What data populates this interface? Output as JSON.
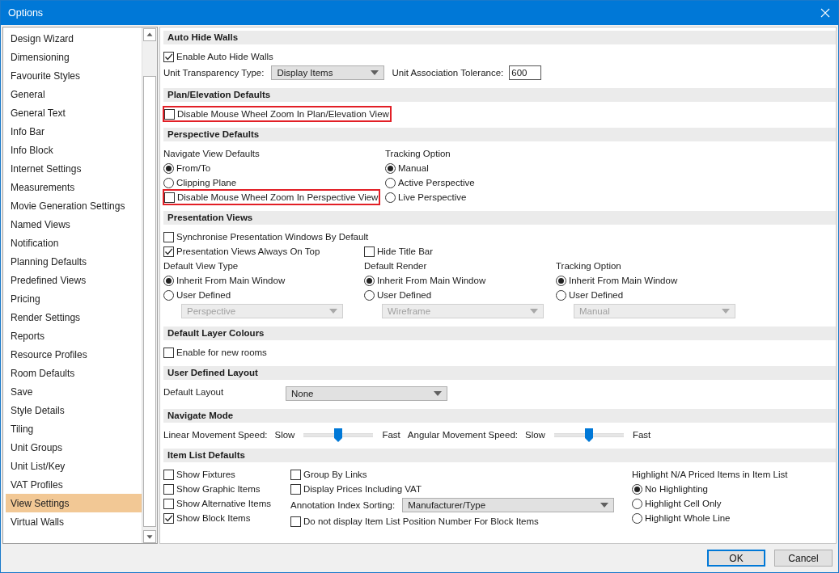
{
  "window": {
    "title": "Options"
  },
  "sidebar": {
    "items": [
      {
        "label": "Design Wizard",
        "selected": false
      },
      {
        "label": "Dimensioning",
        "selected": false
      },
      {
        "label": "Favourite Styles",
        "selected": false
      },
      {
        "label": "General",
        "selected": false
      },
      {
        "label": "General Text",
        "selected": false
      },
      {
        "label": "Info Bar",
        "selected": false
      },
      {
        "label": "Info Block",
        "selected": false
      },
      {
        "label": "Internet Settings",
        "selected": false
      },
      {
        "label": "Measurements",
        "selected": false
      },
      {
        "label": "Movie Generation Settings",
        "selected": false
      },
      {
        "label": "Named Views",
        "selected": false
      },
      {
        "label": "Notification",
        "selected": false
      },
      {
        "label": "Planning Defaults",
        "selected": false
      },
      {
        "label": "Predefined Views",
        "selected": false
      },
      {
        "label": "Pricing",
        "selected": false
      },
      {
        "label": "Render Settings",
        "selected": false
      },
      {
        "label": "Reports",
        "selected": false
      },
      {
        "label": "Resource Profiles",
        "selected": false
      },
      {
        "label": "Room Defaults",
        "selected": false
      },
      {
        "label": "Save",
        "selected": false
      },
      {
        "label": "Style Details",
        "selected": false
      },
      {
        "label": "Tiling",
        "selected": false
      },
      {
        "label": "Unit Groups",
        "selected": false
      },
      {
        "label": "Unit List/Key",
        "selected": false
      },
      {
        "label": "VAT Profiles",
        "selected": false
      },
      {
        "label": "View Settings",
        "selected": true
      },
      {
        "label": "Virtual Walls",
        "selected": false
      }
    ]
  },
  "sections": [
    {
      "title": "Auto Hide Walls",
      "kind": "single",
      "blocks": [
        {
          "columns": [
            [
              {
                "kind": "checkbox",
                "label": "Enable Auto Hide Walls",
                "checked": true,
                "highlighted": false
              }
            ]
          ]
        },
        {
          "columns": [
            [
              {
                "kind": "line",
                "items": [
                  {
                    "kind": "label",
                    "text": "Unit Transparency Type:"
                  },
                  {
                    "kind": "dropdown",
                    "value": "Display Items",
                    "disabled": false
                  },
                  {
                    "kind": "label",
                    "text": "Unit Association Tolerance:"
                  },
                  {
                    "kind": "field",
                    "value": "600"
                  }
                ]
              }
            ]
          ]
        }
      ]
    },
    {
      "title": "Plan/Elevation Defaults",
      "kind": "single",
      "blocks": [
        {
          "columns": [
            [
              {
                "kind": "checkbox",
                "label": "Disable Mouse Wheel Zoom In Plan/Elevation View",
                "checked": false,
                "highlighted": true
              }
            ]
          ]
        }
      ]
    },
    {
      "title": "Perspective Defaults",
      "kind": "two",
      "blocks": [
        {
          "columns": [
            [
              {
                "kind": "label",
                "text": "Navigate View Defaults"
              },
              {
                "kind": "radio",
                "label": "From/To",
                "selected": true
              },
              {
                "kind": "radio",
                "label": "Clipping Plane",
                "selected": false
              },
              {
                "kind": "checkbox",
                "label": "Disable Mouse Wheel Zoom In Perspective View",
                "checked": false,
                "highlighted": true
              }
            ],
            [
              {
                "kind": "label",
                "text": "Tracking Option"
              },
              {
                "kind": "radio",
                "label": "Manual",
                "selected": true
              },
              {
                "kind": "radio",
                "label": "Active Perspective",
                "selected": false
              },
              {
                "kind": "radio",
                "label": "Live Perspective",
                "selected": false
              }
            ]
          ]
        }
      ]
    },
    {
      "title": "Presentation Views",
      "kind": "three",
      "blocks": [
        {
          "columns": [
            [
              {
                "kind": "checkbox",
                "label": "Synchronise Presentation Windows By Default",
                "checked": false,
                "highlighted": false
              }
            ]
          ]
        },
        {
          "columns": [
            [
              {
                "kind": "checkbox",
                "label": "Presentation Views Always On Top",
                "checked": true,
                "highlighted": false
              }
            ],
            [
              {
                "kind": "checkbox",
                "label": "Hide Title Bar",
                "checked": false,
                "highlighted": false
              }
            ]
          ]
        },
        {
          "columns": [
            [
              {
                "kind": "label",
                "text": "Default View Type"
              },
              {
                "kind": "radio",
                "label": "Inherit From Main Window",
                "selected": true
              },
              {
                "kind": "radio",
                "label": "User Defined",
                "selected": false
              },
              {
                "kind": "dropdown",
                "value": "Perspective",
                "disabled": true
              }
            ],
            [
              {
                "kind": "label",
                "text": "Default Render"
              },
              {
                "kind": "radio",
                "label": "Inherit From Main Window",
                "selected": true
              },
              {
                "kind": "radio",
                "label": "User Defined",
                "selected": false
              },
              {
                "kind": "dropdown",
                "value": "Wireframe",
                "disabled": true
              }
            ],
            [
              {
                "kind": "label",
                "text": "Tracking Option"
              },
              {
                "kind": "radio",
                "label": "Inherit From Main Window",
                "selected": true
              },
              {
                "kind": "radio",
                "label": "User Defined",
                "selected": false
              },
              {
                "kind": "dropdown",
                "value": "Manual",
                "disabled": true
              }
            ]
          ]
        }
      ]
    },
    {
      "title": "Default Layer Colours",
      "kind": "single",
      "blocks": [
        {
          "columns": [
            [
              {
                "kind": "checkbox",
                "label": "Enable for new rooms",
                "checked": false,
                "highlighted": false
              }
            ]
          ]
        }
      ]
    },
    {
      "title": "User Defined Layout",
      "kind": "form",
      "blocks": [
        {
          "columns": [
            [
              {
                "kind": "label",
                "text": "Default Layout"
              }
            ],
            [
              {
                "kind": "dropdown",
                "value": "None",
                "disabled": false
              }
            ]
          ]
        }
      ]
    },
    {
      "title": "Navigate Mode",
      "kind": "single",
      "blocks": [
        {
          "columns": [
            [
              {
                "kind": "line",
                "items": [
                  {
                    "kind": "label",
                    "text": "Linear Movement Speed:"
                  },
                  {
                    "kind": "label",
                    "text": "Slow"
                  },
                  {
                    "kind": "slider",
                    "level": 0.5
                  },
                  {
                    "kind": "label",
                    "text": "Fast"
                  },
                  {
                    "kind": "label",
                    "text": "Angular Movement Speed:"
                  },
                  {
                    "kind": "label",
                    "text": "Slow"
                  },
                  {
                    "kind": "slider",
                    "level": 0.5
                  },
                  {
                    "kind": "label",
                    "text": "Fast"
                  }
                ]
              }
            ]
          ]
        }
      ]
    },
    {
      "title": "Item List Defaults",
      "kind": "items",
      "blocks": [
        {
          "columns": [
            [
              {
                "kind": "checkbox",
                "label": "Show Fixtures",
                "checked": false,
                "highlighted": false
              },
              {
                "kind": "checkbox",
                "label": "Show Graphic Items",
                "checked": false,
                "highlighted": false
              },
              {
                "kind": "checkbox",
                "label": "Show Alternative Items",
                "checked": false,
                "highlighted": false
              },
              {
                "kind": "checkbox",
                "label": "Show Block Items",
                "checked": true,
                "highlighted": false
              }
            ],
            [
              {
                "kind": "checkbox",
                "label": "Group By Links",
                "checked": false,
                "highlighted": false
              },
              {
                "kind": "checkbox",
                "label": "Display Prices Including VAT",
                "checked": false,
                "highlighted": false
              },
              {
                "kind": "line",
                "items": [
                  {
                    "kind": "label",
                    "text": "Annotation Index Sorting:"
                  },
                  {
                    "kind": "dropdown",
                    "value": "Manufacturer/Type",
                    "disabled": false
                  }
                ]
              },
              {
                "kind": "checkbox",
                "label": "Do not display Item List Position Number For Block Items",
                "checked": false,
                "highlighted": false
              }
            ],
            [
              {
                "kind": "label",
                "text": "Highlight N/A Priced Items in Item List"
              },
              {
                "kind": "radio",
                "label": "No Highlighting",
                "selected": true
              },
              {
                "kind": "radio",
                "label": "Highlight Cell Only",
                "selected": false
              },
              {
                "kind": "radio",
                "label": "Highlight Whole Line",
                "selected": false
              }
            ]
          ]
        }
      ]
    }
  ],
  "buttons": [
    {
      "label": "OK",
      "default": true
    },
    {
      "label": "Cancel",
      "default": false
    }
  ]
}
